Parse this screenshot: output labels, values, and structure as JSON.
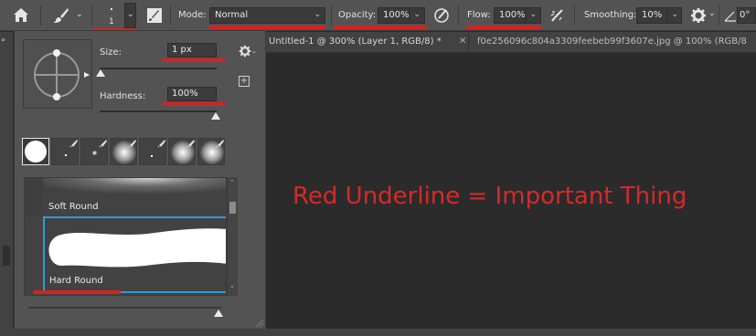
{
  "options_bar": {
    "home_icon": "home-icon",
    "brush_icon": "brush-icon",
    "brush_size_value": "1",
    "mode_label": "Mode:",
    "mode_value": "Normal",
    "opacity_label": "Opacity:",
    "opacity_value": "100%",
    "flow_label": "Flow:",
    "flow_value": "100%",
    "smoothing_label": "Smoothing:",
    "smoothing_value": "10%",
    "angle_value": "0°"
  },
  "tabs": [
    {
      "label": "Untitled-1 @ 300% (Layer 1, RGB/8) *"
    },
    {
      "label": "f0e256096c804a3309feebeb99f3607e.jpg @ 100% (RGB/8"
    }
  ],
  "panel": {
    "size_label": "Size:",
    "size_value": "1 px",
    "hardness_label": "Hardness:",
    "hardness_value": "100%",
    "brush_list": [
      {
        "label": "Soft Round"
      },
      {
        "label": "Hard Round"
      }
    ]
  },
  "annotation": {
    "text": "Red Underline = Important Thing"
  },
  "colors": {
    "accent_red": "#d22323",
    "selection_blue": "#2f9bd6",
    "panel_bg": "#535353",
    "canvas_bg": "#2b2b2b"
  }
}
